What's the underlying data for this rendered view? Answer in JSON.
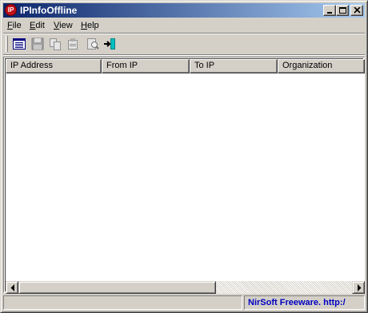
{
  "window": {
    "title": "IPInfoOffline",
    "app_icon_text": "IP"
  },
  "title_buttons": {
    "minimize": "minimize-icon",
    "maximize": "maximize-icon",
    "close": "close-icon"
  },
  "menu": [
    {
      "label": "File",
      "accel": "F",
      "rest": "ile"
    },
    {
      "label": "Edit",
      "accel": "E",
      "rest": "dit"
    },
    {
      "label": "View",
      "accel": "V",
      "rest": "iew"
    },
    {
      "label": "Help",
      "accel": "H",
      "rest": "elp"
    }
  ],
  "toolbar": {
    "icons": [
      "properties-list-icon",
      "save-icon",
      "copy-icon",
      "html-report-icon",
      "find-icon",
      "exit-icon"
    ]
  },
  "list": {
    "columns": [
      "IP Address",
      "From IP",
      "To IP",
      "Organization"
    ],
    "rows": []
  },
  "status": {
    "left": "",
    "right": "NirSoft Freeware.  http:/"
  },
  "colors": {
    "title_start": "#0a246a",
    "title_end": "#a6caf0",
    "status_link": "#0000c0"
  }
}
